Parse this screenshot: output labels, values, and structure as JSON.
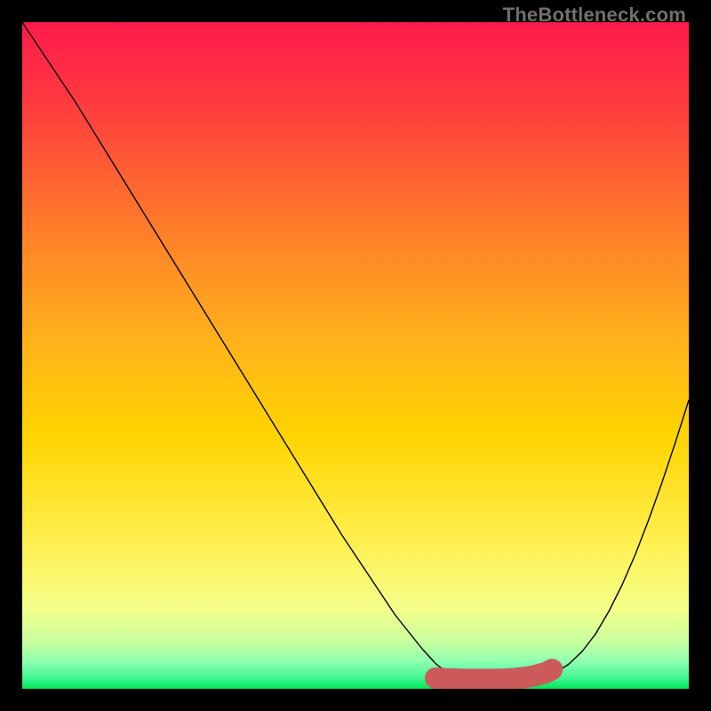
{
  "watermark": "TheBottleneck.com",
  "chart_data": {
    "type": "line",
    "title": "",
    "xlabel": "",
    "ylabel": "",
    "xlim": [
      0,
      100
    ],
    "ylim": [
      0,
      100
    ],
    "grid": false,
    "legend": false,
    "background_gradient": {
      "top_color": "#ff1a4b",
      "mid_color": "#ffd400",
      "bottom_color": "#00e756"
    },
    "series": [
      {
        "name": "bottleneck-curve",
        "color": "#000000",
        "x": [
          0.0,
          4.0,
          8.0,
          12.0,
          16.0,
          20.0,
          24.0,
          28.0,
          32.0,
          36.0,
          40.0,
          44.0,
          48.0,
          52.0,
          56.0,
          60.0,
          62.0,
          64.0,
          66.0,
          68.0,
          70.0,
          72.0,
          74.0,
          76.0,
          78.0,
          80.0,
          82.0,
          84.0,
          86.0,
          88.0,
          90.0,
          92.0,
          94.0,
          96.0,
          98.0,
          100.0
        ],
        "y": [
          100.0,
          94.0,
          88.0,
          81.5,
          75.0,
          68.5,
          62.0,
          55.5,
          49.0,
          42.5,
          36.0,
          29.5,
          23.0,
          17.0,
          11.0,
          6.0,
          3.8,
          2.2,
          1.2,
          0.7,
          0.5,
          0.5,
          0.6,
          0.9,
          1.5,
          2.4,
          3.7,
          5.6,
          8.2,
          11.6,
          15.6,
          20.2,
          25.4,
          31.0,
          37.0,
          43.3
        ]
      },
      {
        "name": "optimal-marker",
        "color": "#cc5a5a",
        "type": "marker-line",
        "x": [
          62.0,
          63.5,
          65.0,
          66.5,
          68.0,
          69.5,
          71.0,
          72.5,
          74.0,
          75.5,
          77.0,
          78.5,
          79.5
        ],
        "y": [
          1.6,
          1.5,
          1.45,
          1.4,
          1.4,
          1.4,
          1.4,
          1.45,
          1.55,
          1.7,
          2.0,
          2.4,
          2.9
        ],
        "endpoint": {
          "x": 79.5,
          "y": 2.9,
          "r": 1.2
        }
      }
    ]
  }
}
